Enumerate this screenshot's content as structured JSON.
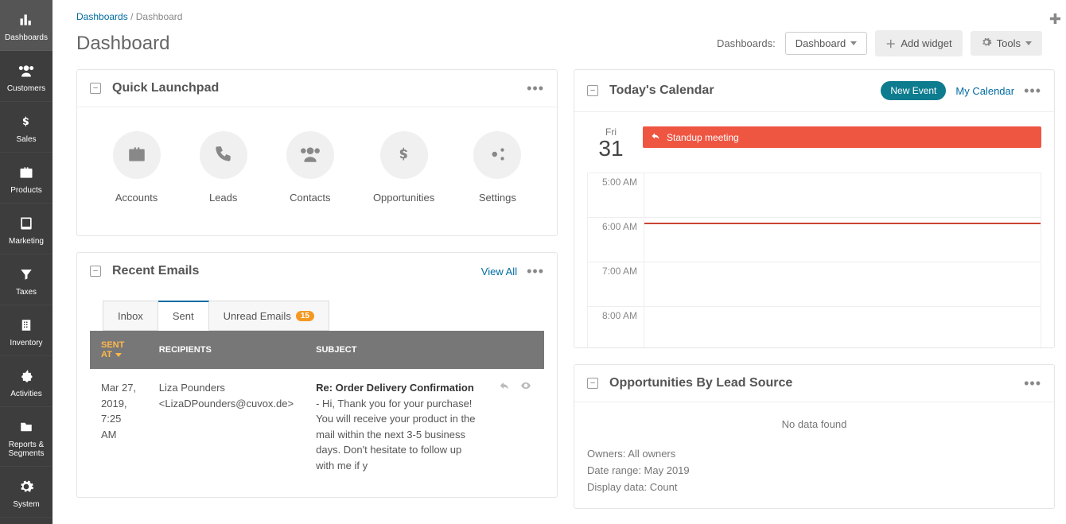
{
  "sidebar": {
    "items": [
      {
        "label": "Dashboards"
      },
      {
        "label": "Customers"
      },
      {
        "label": "Sales"
      },
      {
        "label": "Products"
      },
      {
        "label": "Marketing"
      },
      {
        "label": "Taxes"
      },
      {
        "label": "Inventory"
      },
      {
        "label": "Activities"
      },
      {
        "label": "Reports & Segments"
      },
      {
        "label": "System"
      }
    ]
  },
  "header": {
    "breadcrumb_root": "Dashboards",
    "breadcrumb_sep": "/",
    "breadcrumb_current": "Dashboard",
    "page_title": "Dashboard",
    "dashboards_label": "Dashboards:",
    "dashboard_select": "Dashboard",
    "add_widget": "Add widget",
    "tools": "Tools"
  },
  "launchpad": {
    "title": "Quick Launchpad",
    "items": [
      {
        "label": "Accounts"
      },
      {
        "label": "Leads"
      },
      {
        "label": "Contacts"
      },
      {
        "label": "Opportunities"
      },
      {
        "label": "Settings"
      }
    ]
  },
  "emails": {
    "title": "Recent Emails",
    "view_all": "View All",
    "tabs": {
      "inbox": "Inbox",
      "sent": "Sent",
      "unread": "Unread Emails",
      "unread_count": "15"
    },
    "columns": {
      "sent_at": "SENT AT",
      "recipients": "RECIPIENTS",
      "subject": "SUBJECT"
    },
    "rows": [
      {
        "sent_at": "Mar 27, 2019, 7:25 AM",
        "recipient_name": "Liza Pounders",
        "recipient_email": "<LizaDPounders@cuvox.de>",
        "subject": "Re: Order Delivery Confirmation",
        "preview": " - Hi, Thank you for your purchase! You will receive your product in the mail within the next 3-5 business days. Don't hesitate to follow up with me if y"
      }
    ]
  },
  "calendar": {
    "title": "Today's Calendar",
    "new_event": "New Event",
    "my_calendar": "My Calendar",
    "day_of_week": "Fri",
    "day_num": "31",
    "event_title": "Standup meeting",
    "hours": [
      "5:00 AM",
      "6:00 AM",
      "7:00 AM",
      "8:00 AM"
    ]
  },
  "opportunities": {
    "title": "Opportunities By Lead Source",
    "no_data": "No data found",
    "owners_label": "Owners: ",
    "owners_value": "All owners",
    "range_label": "Date range: ",
    "range_value": "May 2019",
    "display_label": "Display data: ",
    "display_value": "Count"
  }
}
